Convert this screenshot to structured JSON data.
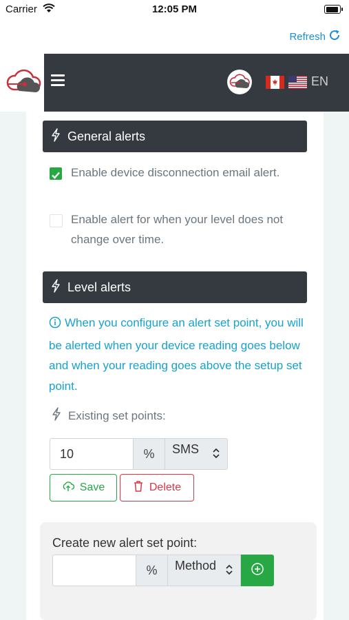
{
  "status_bar": {
    "carrier": "Carrier",
    "time": "12:05 PM"
  },
  "header": {
    "refresh_label": "Refresh",
    "language": "EN"
  },
  "general_alerts": {
    "title": "General alerts",
    "options": [
      {
        "label": "Enable device disconnection email alert.",
        "checked": true
      },
      {
        "label": "Enable alert for when your level does not change over time.",
        "checked": false
      }
    ]
  },
  "level_alerts": {
    "title": "Level alerts",
    "info": "When you configure an alert set point, you will be alerted when your device reading goes below and when your reading goes above the setup set point.",
    "existing_label": "Existing set points:",
    "set_points": [
      {
        "value": "10",
        "unit": "%",
        "method": "SMS"
      }
    ],
    "save_label": "Save",
    "delete_label": "Delete"
  },
  "new_set_point": {
    "label": "Create new alert set point:",
    "value": "",
    "unit": "%",
    "method_placeholder": "Method"
  },
  "colors": {
    "accent": "#28a745",
    "danger": "#dc3545",
    "info": "#17a2cc",
    "dark": "#343a40",
    "link": "#1a8fd6"
  }
}
